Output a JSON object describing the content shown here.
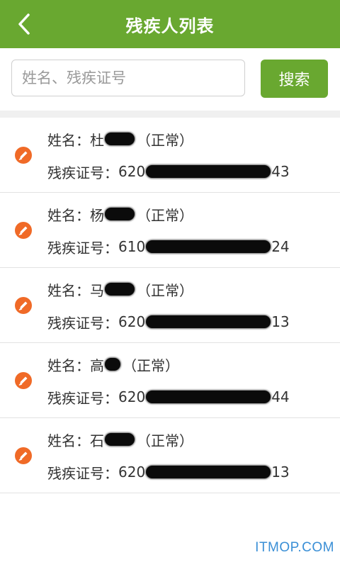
{
  "header": {
    "title": "残疾人列表",
    "back_icon": "chevron-left-icon"
  },
  "search": {
    "placeholder": "姓名、残疾证号",
    "value": "",
    "button_label": "搜索"
  },
  "colors": {
    "brand_green": "#69a830",
    "edit_icon_orange": "#f06a27",
    "watermark_blue": "#3a8fd6"
  },
  "list": {
    "name_label": "姓名：",
    "id_label": "残疾证号：",
    "items": [
      {
        "surname": "杜",
        "status": "（正常）",
        "id_prefix": "620",
        "id_suffix": "43"
      },
      {
        "surname": "杨",
        "status": "（正常）",
        "id_prefix": "610",
        "id_suffix": "24"
      },
      {
        "surname": "马",
        "status": "（正常）",
        "id_prefix": "620",
        "id_suffix": "13"
      },
      {
        "surname": "高",
        "status": "（正常）",
        "id_prefix": "620",
        "id_suffix": "44"
      },
      {
        "surname": "石",
        "status": "（正常）",
        "id_prefix": "620",
        "id_suffix": "13"
      }
    ]
  },
  "watermark": "ITMOP.COM"
}
